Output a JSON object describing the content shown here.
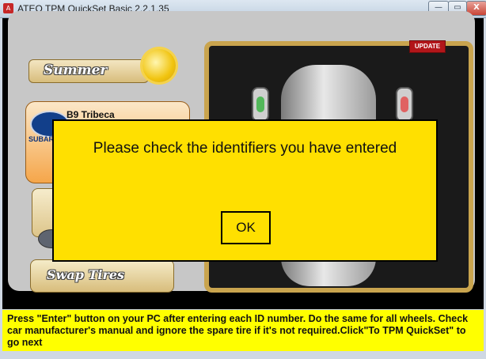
{
  "window": {
    "title": "ATEQ TPM QuickSet Basic  2.2.1.35",
    "icon": "app-icon",
    "controls": {
      "minimize": "—",
      "maximize": "▭",
      "close": "X"
    }
  },
  "app": {
    "summer_label": "Summer",
    "vehicle": {
      "brand": "SUBARU",
      "model": "B9 Tribeca"
    },
    "swap_tires_label": "Swap Tires",
    "update_label": "UPDATE",
    "tire_status": {
      "front_left": "green",
      "front_right": "red"
    }
  },
  "dialog": {
    "message": "Please check the identifiers you have entered",
    "ok_label": "OK"
  },
  "instructions": "Press \"Enter\" button on your PC after entering each ID number. Do the same for all wheels. Check car manufacturer's manual and ignore the spare tire if it's not required.Click\"To TPM QuickSet\" to go next",
  "colors": {
    "dialog_bg": "#ffe000",
    "instruction_bg": "#ffff00",
    "frame_gold": "#c9a44e"
  }
}
